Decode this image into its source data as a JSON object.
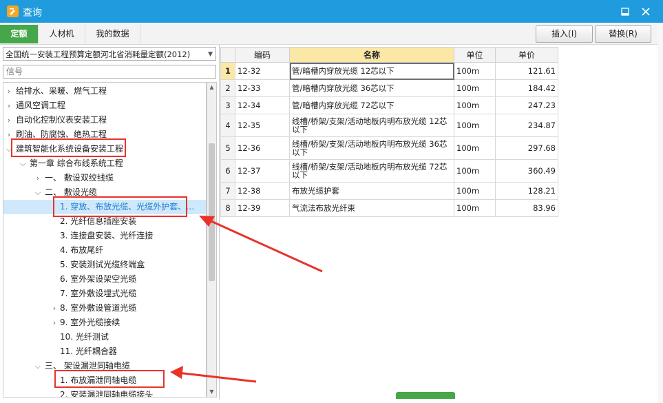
{
  "window": {
    "title": "查询",
    "minimize_icon": "minimize-icon",
    "close_icon": "close-icon"
  },
  "tabs": [
    {
      "label": "定额",
      "active": true
    },
    {
      "label": "人材机",
      "active": false
    },
    {
      "label": "我的数据",
      "active": false
    }
  ],
  "toolbar": {
    "insert_label": "插入(I)",
    "replace_label": "替换(R)"
  },
  "left_panel": {
    "quota_library": "全国统一安装工程预算定额河北省消耗量定额(2012)",
    "search_placeholder": "信号",
    "tree": [
      {
        "label": "给排水、采暖、燃气工程",
        "level": 0,
        "state": "collapsed"
      },
      {
        "label": "通风空调工程",
        "level": 0,
        "state": "collapsed"
      },
      {
        "label": "自动化控制仪表安装工程",
        "level": 0,
        "state": "collapsed"
      },
      {
        "label": "刷油、防腐蚀、绝热工程",
        "level": 0,
        "state": "collapsed"
      },
      {
        "label": "建筑智能化系统设备安装工程",
        "level": 0,
        "state": "expanded"
      },
      {
        "label": "第一章 综合布线系统工程",
        "level": 1,
        "state": "expanded"
      },
      {
        "label": "一、 敷设双绞线缆",
        "level": 2,
        "state": "collapsed"
      },
      {
        "label": "二、 敷设光缆",
        "level": 2,
        "state": "expanded"
      },
      {
        "label": "1. 穿放、布放光缆、光缆外护套、…",
        "level": 3,
        "state": "leaf",
        "selected": true
      },
      {
        "label": "2. 光纤信息插座安装",
        "level": 3,
        "state": "leaf"
      },
      {
        "label": "3. 连接盘安装、光纤连接",
        "level": 3,
        "state": "leaf"
      },
      {
        "label": "4. 布放尾纤",
        "level": 3,
        "state": "leaf"
      },
      {
        "label": "5. 安装测试光缆终端盒",
        "level": 3,
        "state": "leaf"
      },
      {
        "label": "6. 室外架设架空光缆",
        "level": 3,
        "state": "leaf"
      },
      {
        "label": "7. 室外敷设埋式光缆",
        "level": 3,
        "state": "leaf"
      },
      {
        "label": "8. 室外敷设管道光缆",
        "level": 3,
        "state": "collapsed"
      },
      {
        "label": "9. 室外光缆接续",
        "level": 3,
        "state": "collapsed"
      },
      {
        "label": "10. 光纤测试",
        "level": 3,
        "state": "leaf"
      },
      {
        "label": "11. 光纤耦合器",
        "level": 3,
        "state": "leaf"
      },
      {
        "label": "三、 架设漏泄同轴电缆",
        "level": 2,
        "state": "expanded"
      },
      {
        "label": "1. 布放漏泄同轴电缆",
        "level": 3,
        "state": "leaf"
      },
      {
        "label": "2. 安装漏泄同轴电缆接头",
        "level": 3,
        "state": "leaf"
      }
    ]
  },
  "grid": {
    "columns": [
      "编码",
      "名称",
      "单位",
      "单价"
    ],
    "rows": [
      {
        "no": "1",
        "code": "12-32",
        "name": "管/暗槽内穿放光缆 12芯以下",
        "unit": "100m",
        "price": "121.61"
      },
      {
        "no": "2",
        "code": "12-33",
        "name": "管/暗槽内穿放光缆 36芯以下",
        "unit": "100m",
        "price": "184.42"
      },
      {
        "no": "3",
        "code": "12-34",
        "name": "管/暗槽内穿放光缆 72芯以下",
        "unit": "100m",
        "price": "247.23"
      },
      {
        "no": "4",
        "code": "12-35",
        "name": "线槽/桥架/支架/活动地板内明布放光缆 12芯以下",
        "unit": "100m",
        "price": "234.87"
      },
      {
        "no": "5",
        "code": "12-36",
        "name": "线槽/桥架/支架/活动地板内明布放光缆 36芯以下",
        "unit": "100m",
        "price": "297.68"
      },
      {
        "no": "6",
        "code": "12-37",
        "name": "线槽/桥架/支架/活动地板内明布放光缆 72芯以下",
        "unit": "100m",
        "price": "360.49"
      },
      {
        "no": "7",
        "code": "12-38",
        "name": "布放光缆护套",
        "unit": "100m",
        "price": "128.21"
      },
      {
        "no": "8",
        "code": "12-39",
        "name": "气流法布放光纤束",
        "unit": "100m",
        "price": "83.96"
      }
    ]
  },
  "colors": {
    "titlebar": "#1f9bde",
    "active_tab": "#45a74a",
    "annotation": "#e8322a",
    "header_highlight": "#fbe7a6"
  }
}
